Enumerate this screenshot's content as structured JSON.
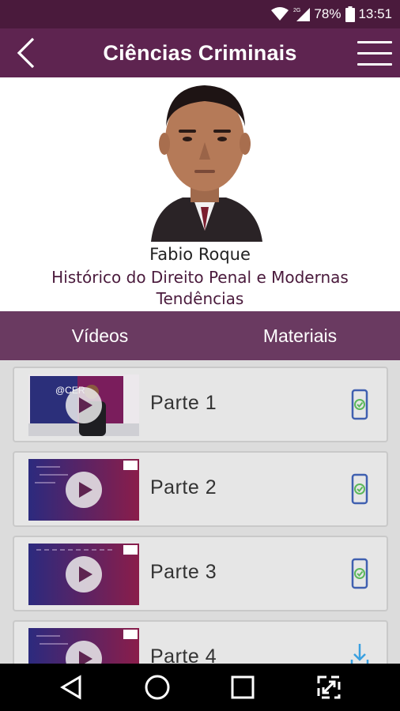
{
  "status_bar": {
    "battery": "78%",
    "time": "13:51",
    "network": "2G",
    "icons": [
      "wifi-icon",
      "signal-icon",
      "battery-icon"
    ]
  },
  "header": {
    "title": "Ciências Criminais",
    "icons": [
      "back-arrow-icon",
      "hamburger-menu-icon"
    ]
  },
  "professor": {
    "name": "Fabio Roque",
    "course": "Histórico do Direito Penal e Modernas Tendências"
  },
  "tabs": [
    {
      "label": "Vídeos"
    },
    {
      "label": "Materiais"
    }
  ],
  "videos": [
    {
      "label": "Parte 1",
      "status_icon": "phone-check-icon"
    },
    {
      "label": "Parte 2",
      "status_icon": "phone-check-icon"
    },
    {
      "label": "Parte 3",
      "status_icon": "phone-check-icon"
    },
    {
      "label": "Parte 4",
      "status_icon": "download-icon"
    }
  ],
  "nav_bar": {
    "icons": [
      "back-triangle-icon",
      "home-circle-icon",
      "recents-square-icon",
      "expand-icon"
    ]
  },
  "colors": {
    "status_bar": "#4a1a3c",
    "app_bar": "#5e2450",
    "tabs": "#6a3a61",
    "list_bg": "#dcdcdc",
    "check_green": "#5cb85c",
    "download_blue": "#3aa0e0"
  }
}
